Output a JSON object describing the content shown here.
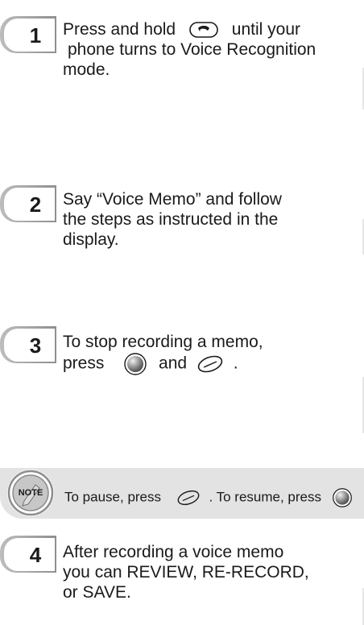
{
  "steps": [
    {
      "number": "1",
      "line1_before": "Press and hold",
      "line1_after": "until your",
      "line2": "phone turns to Voice Recognition",
      "line3": "mode.",
      "icon": "end-call-key-icon"
    },
    {
      "number": "2",
      "line1": "Say “Voice Memo” and follow",
      "line2": "the steps as instructed in the",
      "line3": "display."
    },
    {
      "number": "3",
      "line1": "To stop recording a memo,",
      "line2_before": "press",
      "line2_mid": "and",
      "line2_after": ".",
      "icons": [
        "ok-center-key-icon",
        "soft-key-icon"
      ]
    },
    {
      "number": "4",
      "line1": "After recording a voice memo",
      "line2": "you can REVIEW, RE-RECORD,",
      "line3": "or SAVE."
    }
  ],
  "note": {
    "badge": "NOTE",
    "text_before": "To pause, press",
    "text_mid": ". To resume, press",
    "icons": [
      "soft-key-icon",
      "ok-center-key-icon"
    ]
  },
  "colors": {
    "text": "#1a1a1a",
    "note_background": "#e3e3e3",
    "badge_gray": "#9a9a9a"
  }
}
